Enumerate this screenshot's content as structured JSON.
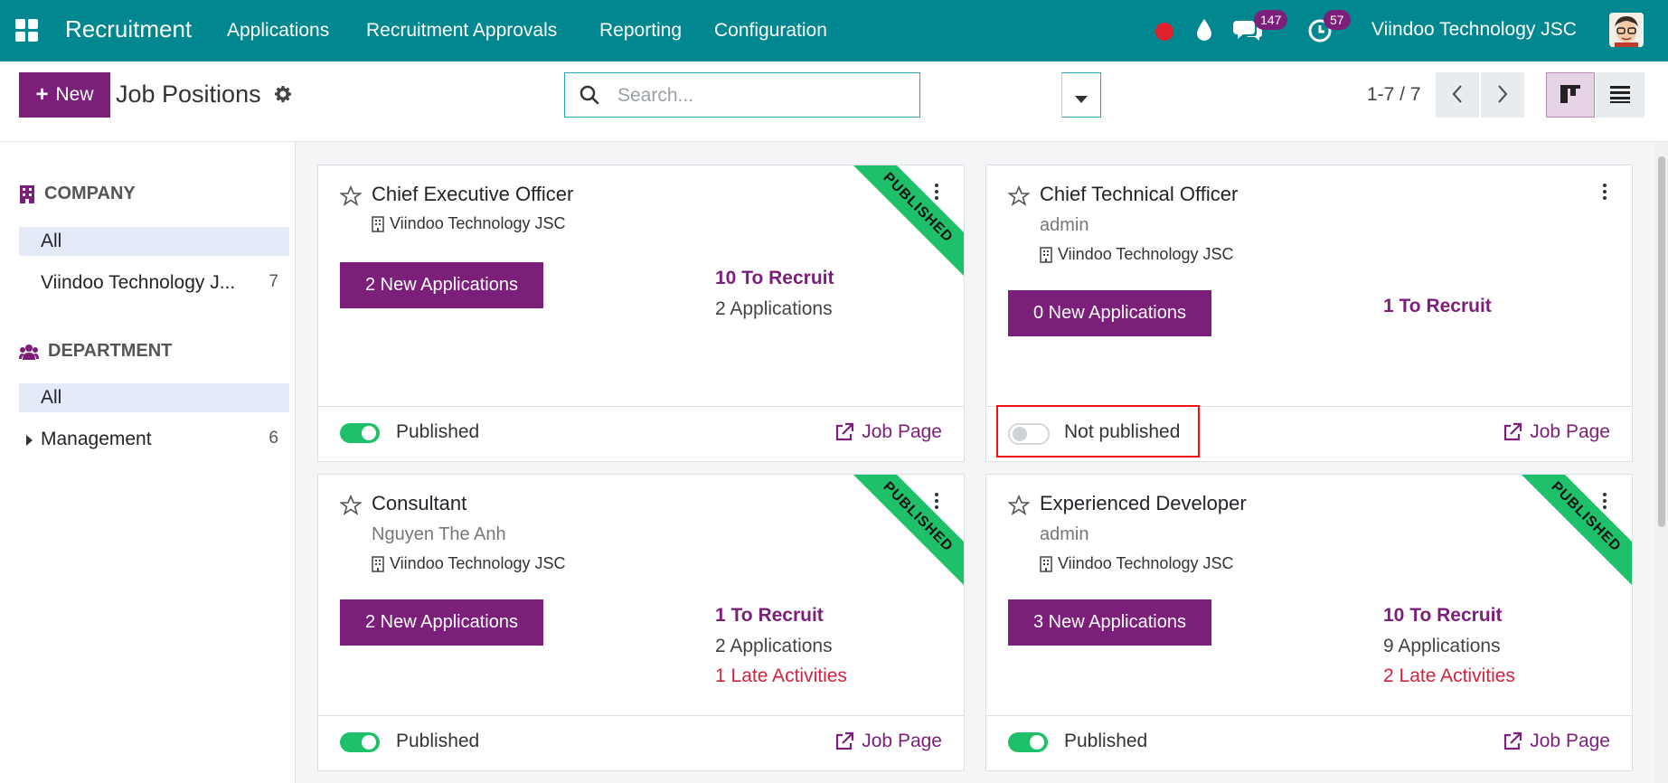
{
  "navbar": {
    "app_name": "Recruitment",
    "menus": [
      "Applications",
      "Recruitment Approvals",
      "Reporting",
      "Configuration"
    ],
    "messages_count": "147",
    "activities_count": "57",
    "company": "Viindoo Technology JSC",
    "accent_color": "#00878f"
  },
  "control": {
    "new_label": "New",
    "title": "Job Positions",
    "search_placeholder": "Search...",
    "pager": "1-7 / 7"
  },
  "sidebar": {
    "company_heading": "COMPANY",
    "company_items": [
      {
        "label": "All",
        "count": ""
      },
      {
        "label": "Viindoo Technology J...",
        "count": "7"
      }
    ],
    "department_heading": "DEPARTMENT",
    "department_items": [
      {
        "label": "All",
        "count": ""
      },
      {
        "label": "Management",
        "count": "6"
      }
    ]
  },
  "cards": [
    {
      "title": "Chief Executive Officer",
      "recruiter": "",
      "company": "Viindoo Technology JSC",
      "new_applications": "2 New Applications",
      "to_recruit": "10 To Recruit",
      "applications": "2 Applications",
      "late": "",
      "published": true,
      "status_label": "Published",
      "ribbon": "PUBLISHED",
      "job_page": "Job Page"
    },
    {
      "title": "Chief Technical Officer",
      "recruiter": "admin",
      "company": "Viindoo Technology JSC",
      "new_applications": "0 New Applications",
      "to_recruit": "1 To Recruit",
      "applications": "",
      "late": "",
      "published": false,
      "status_label": "Not published",
      "ribbon": "",
      "job_page": "Job Page"
    },
    {
      "title": "Consultant",
      "recruiter": "Nguyen The Anh",
      "company": "Viindoo Technology JSC",
      "new_applications": "2 New Applications",
      "to_recruit": "1 To Recruit",
      "applications": "2 Applications",
      "late": "1 Late Activities",
      "published": true,
      "status_label": "Published",
      "ribbon": "PUBLISHED",
      "job_page": "Job Page"
    },
    {
      "title": "Experienced Developer",
      "recruiter": "admin",
      "company": "Viindoo Technology JSC",
      "new_applications": "3 New Applications",
      "to_recruit": "10 To Recruit",
      "applications": "9 Applications",
      "late": "2 Late Activities",
      "published": true,
      "status_label": "Published",
      "ribbon": "PUBLISHED",
      "job_page": "Job Page"
    }
  ]
}
